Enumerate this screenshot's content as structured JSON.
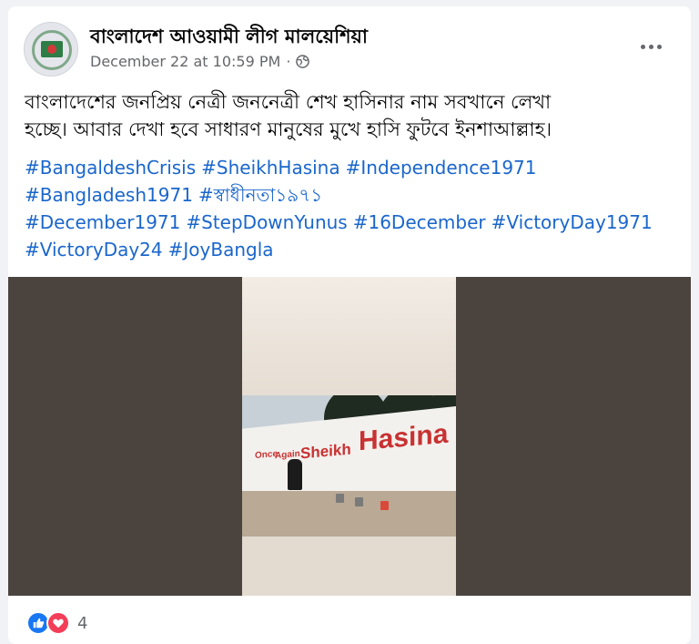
{
  "post": {
    "page_name": "বাংলাদেশ আওয়ামী লীগ মালয়েশিয়া",
    "timestamp": "December 22 at 10:59 PM",
    "separator": "·",
    "body_line1": "বাংলাদেশের জনপ্রিয় নেত্রী জননেত্রী শেখ হাসিনার নাম সবখানে লেখা",
    "body_line2": "হচ্ছে। আবার দেখা হবে সাধারণ মানুষের মুখে হাসি ফুটবে ইনশাআল্লাহ।",
    "hashtags": [
      "#BangaldeshCrisis",
      "#SheikhHasina",
      "#Independence1971",
      "#Bangladesh1971",
      "#স্বাধীনতা১৯৭১",
      "#December1971",
      "#StepDownYunus",
      "#16December",
      "#VictoryDay1971",
      "#VictoryDay24",
      "#JoyBangla"
    ]
  },
  "media": {
    "wall_text_big": "Hasina",
    "wall_text_mid": "Sheikh",
    "wall_text_small_1": "Again",
    "wall_text_small_2": "Once"
  },
  "reactions": {
    "count": "4",
    "icons": [
      "like-icon",
      "love-icon"
    ]
  },
  "colors": {
    "link": "#1a66cc",
    "meta": "#65676b",
    "like": "#1877f2",
    "love": "#f33e58"
  }
}
